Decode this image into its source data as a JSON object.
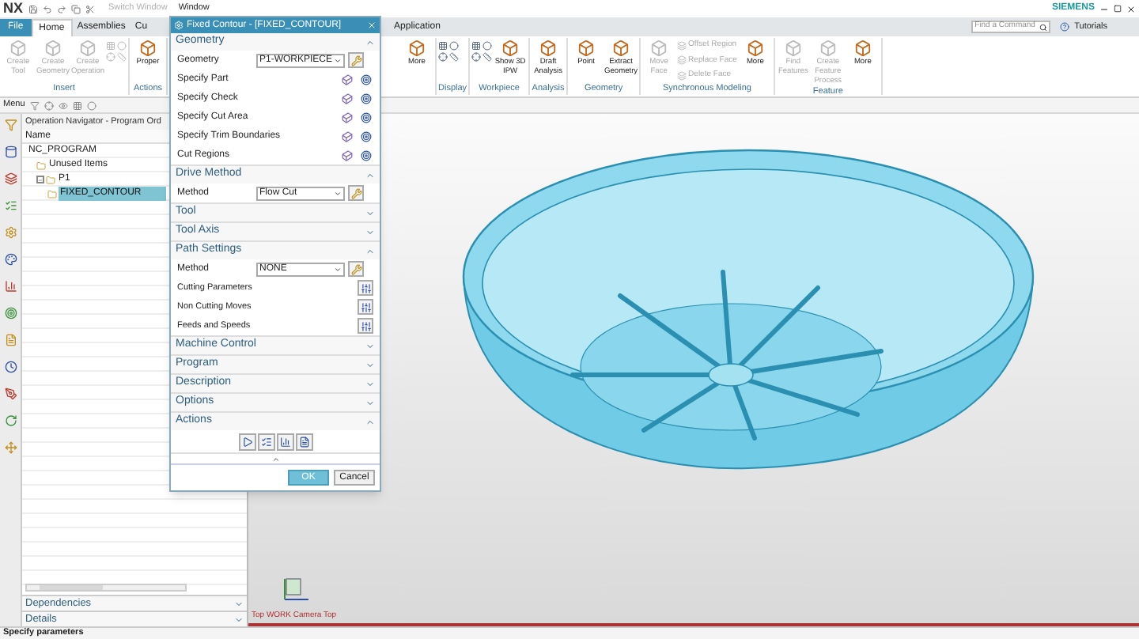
{
  "title_bar": {
    "logo": "NX",
    "switch_window": "Switch Window",
    "window_menu": "Window",
    "brand": "SIEMENS"
  },
  "tabs": [
    {
      "label": "File",
      "selected": false,
      "kind": "file"
    },
    {
      "label": "Home",
      "selected": true,
      "kind": "tab"
    },
    {
      "label": "Assemblies",
      "selected": false,
      "kind": "tab"
    },
    {
      "label": "Cu",
      "selected": false,
      "kind": "tab"
    },
    {
      "label": "Application",
      "selected": false,
      "kind": "gap"
    }
  ],
  "command_search": {
    "placeholder": "Find a Command"
  },
  "tutorials": "Tutorials",
  "ribbon": {
    "left_groups": [
      {
        "label": "Insert",
        "buttons": [
          {
            "label": "Create Tool",
            "kind": "large",
            "disabled": true
          },
          {
            "label": "Create Geometry",
            "kind": "large",
            "disabled": true
          },
          {
            "label": "Create Operation",
            "kind": "large",
            "disabled": true
          },
          {
            "kind": "icons",
            "disabled": true
          }
        ]
      },
      {
        "label": "Actions",
        "buttons": [
          {
            "label": "Proper",
            "kind": "large",
            "disabled": false
          }
        ]
      }
    ],
    "right_groups": [
      {
        "buttons": [
          {
            "label": "More",
            "kind": "large",
            "disabled": false
          }
        ]
      },
      {
        "label": "Display",
        "buttons": [
          {
            "kind": "icons",
            "disabled": false
          }
        ]
      },
      {
        "label": "Workpiece",
        "buttons": [
          {
            "kind": "icons",
            "disabled": false
          },
          {
            "label": "Show 3D IPW",
            "kind": "large",
            "disabled": false
          }
        ]
      },
      {
        "label": "Analysis",
        "buttons": [
          {
            "label": "Draft Analysis",
            "kind": "large",
            "disabled": false
          }
        ]
      },
      {
        "label": "Geometry",
        "buttons": [
          {
            "label": "Point",
            "kind": "large",
            "disabled": false
          },
          {
            "label": "Extract Geometry",
            "kind": "large",
            "disabled": false
          }
        ]
      },
      {
        "label": "Synchronous Modeling",
        "buttons": [
          {
            "label": "Move Face",
            "kind": "large",
            "disabled": true
          },
          {
            "label": "Offset Region",
            "kind": "small",
            "disabled": true
          },
          {
            "label": "Replace Face",
            "kind": "small",
            "disabled": true
          },
          {
            "label": "Delete Face",
            "kind": "small",
            "disabled": true
          },
          {
            "label": "More",
            "kind": "large",
            "disabled": false
          }
        ]
      },
      {
        "label": "Feature",
        "buttons": [
          {
            "label": "Find Features",
            "kind": "large",
            "disabled": true
          },
          {
            "label": "Create Feature Process",
            "kind": "large",
            "disabled": true
          },
          {
            "label": "More",
            "kind": "large",
            "disabled": false
          }
        ]
      }
    ]
  },
  "toolbar": {
    "menu": "Menu"
  },
  "navigator": {
    "title": "Operation Navigator - Program Ord",
    "column": "Name",
    "tree": [
      {
        "label": "NC_PROGRAM",
        "selected": false,
        "children": [
          {
            "label": "Unused Items",
            "selected": false
          },
          {
            "label": "P1",
            "selected": false,
            "expanded": true,
            "children": [
              {
                "label": "FIXED_CONTOUR",
                "selected": true
              }
            ]
          }
        ]
      }
    ],
    "panels": [
      {
        "label": "Dependencies",
        "expanded": false
      },
      {
        "label": "Details",
        "expanded": false
      }
    ]
  },
  "dialog": {
    "title": "Fixed Contour - [FIXED_CONTOUR]",
    "sections": [
      {
        "title": "Geometry",
        "expanded": true,
        "rows": [
          {
            "kind": "select",
            "label": "Geometry",
            "value": "P1-WORKPIECE"
          },
          {
            "kind": "pick",
            "label": "Specify Part"
          },
          {
            "kind": "pick",
            "label": "Specify Check"
          },
          {
            "kind": "pick",
            "label": "Specify Cut Area"
          },
          {
            "kind": "pick",
            "label": "Specify Trim Boundaries"
          },
          {
            "kind": "pick",
            "label": "Cut Regions"
          }
        ]
      },
      {
        "title": "Drive Method",
        "expanded": true,
        "rows": [
          {
            "kind": "select",
            "label": "Method",
            "value": "Flow Cut"
          }
        ]
      },
      {
        "title": "Tool",
        "expanded": false
      },
      {
        "title": "Tool Axis",
        "expanded": false
      },
      {
        "title": "Path Settings",
        "expanded": true,
        "rows": [
          {
            "kind": "select",
            "label": "Method",
            "value": "NONE"
          },
          {
            "kind": "action",
            "label": "Cutting Parameters"
          },
          {
            "kind": "action",
            "label": "Non Cutting Moves"
          },
          {
            "kind": "action",
            "label": "Feeds and Speeds"
          }
        ]
      },
      {
        "title": "Machine Control",
        "expanded": false
      },
      {
        "title": "Program",
        "expanded": false
      },
      {
        "title": "Description",
        "expanded": false
      },
      {
        "title": "Options",
        "expanded": false
      },
      {
        "title": "Actions",
        "expanded": true,
        "rows": [
          {
            "kind": "icons"
          }
        ]
      }
    ],
    "buttons": [
      "OK",
      "Cancel"
    ]
  },
  "viewport": {
    "view_label": "Top WORK Camera Top"
  },
  "status_bar": "Specify parameters"
}
